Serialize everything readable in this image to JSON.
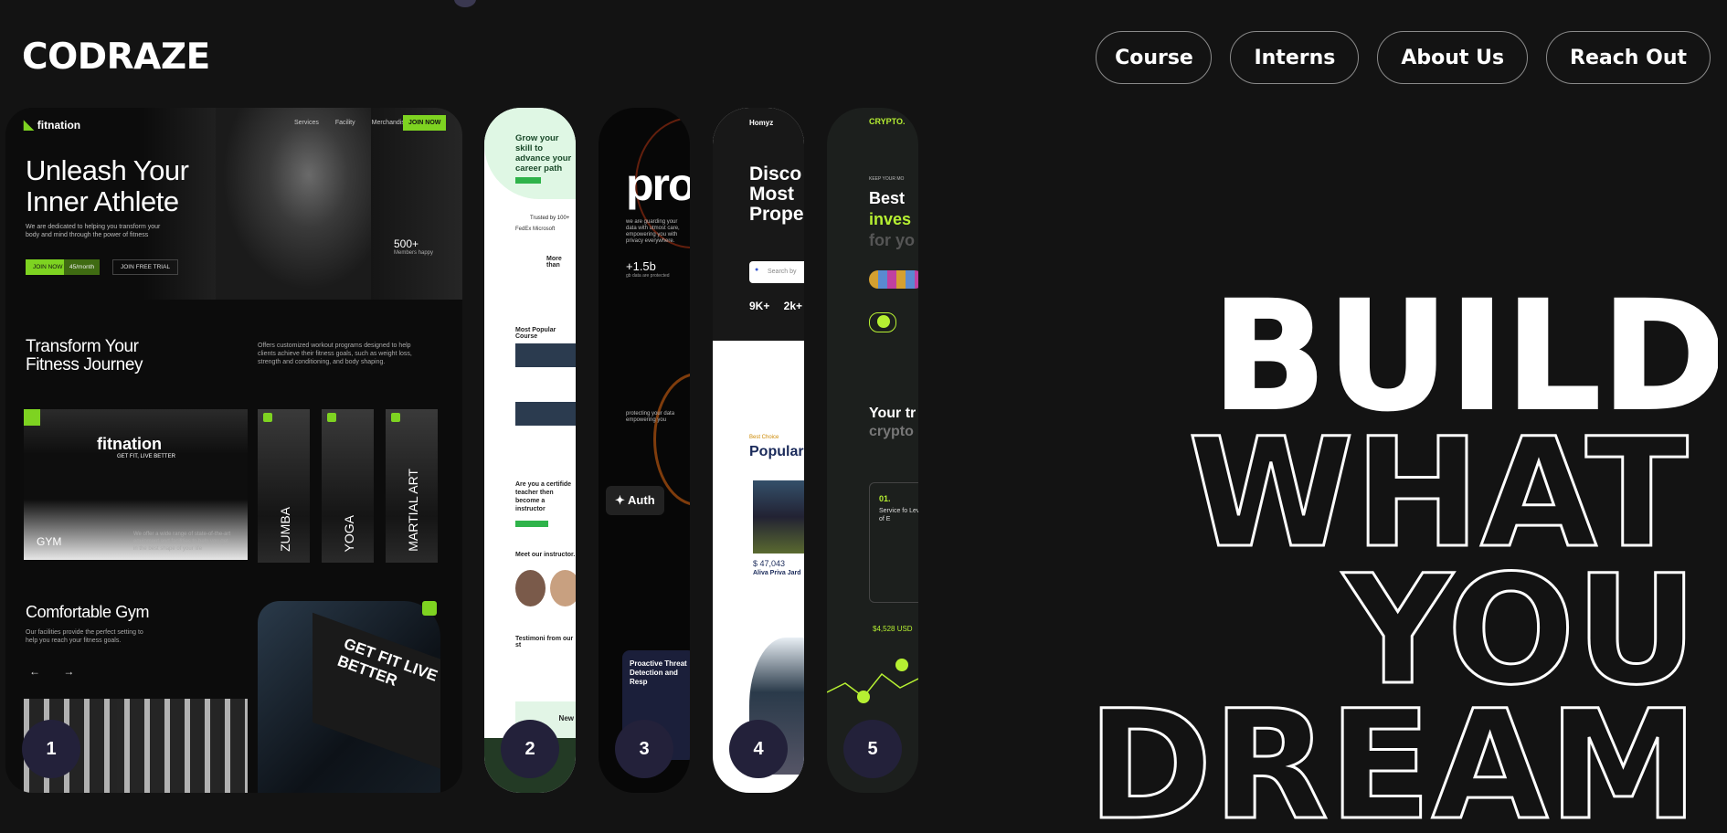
{
  "brand": "CODRAZE",
  "nav": [
    "Course",
    "Interns",
    "About Us",
    "Reach Out"
  ],
  "hero_lines": [
    "BUILD",
    "WHAT",
    "YOU",
    "DREAM"
  ],
  "cards": [
    {
      "number": "1",
      "logo": "fitnation",
      "nav": [
        "Services",
        "Facility",
        "Merchandise"
      ],
      "join": "JOIN NOW",
      "headline": "Unleash Your Inner Athlete",
      "sub": "We are dedicated to helping you transform your body and mind through the power of fitness",
      "btn_join": "JOIN NOW",
      "btn_price": "45/month",
      "btn_trial": "JOIN FREE TRIAL",
      "members": "500+",
      "members_label": "Members happy",
      "section2": "Transform Your Fitness Journey",
      "section2_text": "Offers customized workout programs designed to help clients achieve their fitness goals, such as weight loss, strength and conditioning, and body shaping.",
      "gym_sign": "fitnation",
      "gym_tag": "GET FIT, LIVE BETTER",
      "gym_label": "GYM",
      "gym_text": "We offer a wide range of state-of-the-art equipment and facilities to help you get in the best shape of your life",
      "tiles": [
        "ZUMBA",
        "YOGA",
        "MARTIAL ART"
      ],
      "section3": "Comfortable Gym",
      "section3_text": "Our facilities provide the perfect setting to help you reach your fitness goals.",
      "arrows": "← →",
      "billboard": "GET FIT LIVE BETTER"
    },
    {
      "number": "2",
      "headline": "Grow your skill to advance your career path",
      "trusted": "Trusted by 100+",
      "brands": "FedEx  Microsoft",
      "more": "More than",
      "popular": "Most Popular Course",
      "teacher": "Are you a certifide teacher then become a instructor",
      "instructor": "Meet our instructor.",
      "testimoni": "Testimoni from our st",
      "new": "New"
    },
    {
      "number": "3",
      "title": "pro",
      "text": "we are guarding your data with utmost care, empowering you with privacy everywhere.",
      "stat": "+1.5b",
      "stat_label": "gb data are protected",
      "protect": "protecting your data empowering you",
      "auth": "Auth",
      "threat": "Proactive Threat Detection and Resp"
    },
    {
      "number": "4",
      "brand": "Homyz",
      "headline": "Disco Most Prope",
      "search": "Search by",
      "stats": "9K+ 2k+",
      "editor": "Best Choice",
      "popular": "Popular",
      "price": "$ 47,043",
      "property": "Aliva Priva Jard"
    },
    {
      "number": "5",
      "brand": "CRYPTO.",
      "kicker": "KEEP YOUR MO",
      "line1": "Best",
      "line2": "inves",
      "line3": "for yo",
      "your": "Your tr",
      "crypto": "crypto",
      "box_num": "01.",
      "box_text": "Service fo Level of E",
      "usd": "$4,528 USD"
    }
  ],
  "colors": {
    "accent_green": "#7ed321",
    "crypto_green": "#b6f032",
    "number_bg": "#23213a"
  }
}
